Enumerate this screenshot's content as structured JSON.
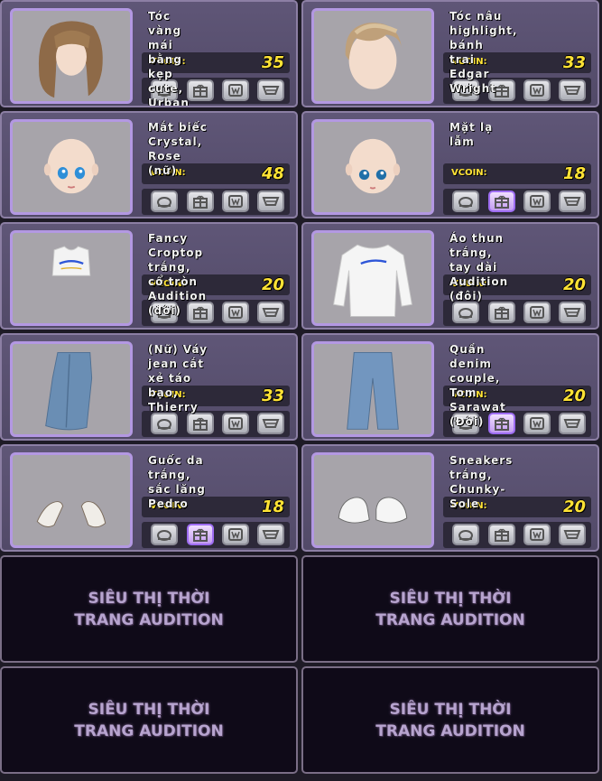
{
  "currency_label": "VCOIN:",
  "items": [
    {
      "name": "Tóc vàng mái bằng kẹp cute, Urban",
      "price": "35",
      "thumb": "hair-blonde",
      "active_button": ""
    },
    {
      "name": "Tóc nâu highlight, bánh trai Edgar Wright",
      "price": "33",
      "thumb": "hair-short",
      "active_button": ""
    },
    {
      "name": "Mắt biếc Crystal, Rose (nữ)",
      "price": "48",
      "thumb": "face-female",
      "active_button": ""
    },
    {
      "name": "Mặt lạ lẫm",
      "price": "18",
      "thumb": "face-male",
      "active_button": "gift"
    },
    {
      "name": "Fancy Croptop trắng, cổ tròn Audition (đôi)",
      "price": "20",
      "thumb": "croptop",
      "active_button": ""
    },
    {
      "name": "Áo thun trắng, tay dài Audition (đôi)",
      "price": "20",
      "thumb": "longsleeve",
      "active_button": ""
    },
    {
      "name": "(Nữ) Váy jean cắt xẻ táo bạo, Thierry",
      "price": "33",
      "thumb": "skirt",
      "active_button": ""
    },
    {
      "name": "Quần denim couple, Tom Sarawat (Đôi)",
      "price": "20",
      "thumb": "jeans",
      "active_button": "gift"
    },
    {
      "name": "Guốc da trắng, sắc lăng Pedro",
      "price": "18",
      "thumb": "heels",
      "active_button": "gift"
    },
    {
      "name": "Sneakers trắng, Chunky-Sole",
      "price": "20",
      "thumb": "sneakers",
      "active_button": ""
    }
  ],
  "ads": [
    {
      "line1": "SIÊU THỊ THỜI",
      "line2": "TRANG AUDITION"
    },
    {
      "line1": "SIÊU THỊ THỜI",
      "line2": "TRANG AUDITION"
    },
    {
      "line1": "SIÊU THỊ THỜI",
      "line2": "TRANG AUDITION"
    },
    {
      "line1": "SIÊU THỊ THỜI",
      "line2": "TRANG AUDITION"
    }
  ],
  "button_icons": [
    "preview-icon",
    "gift-icon",
    "wishlist-icon",
    "cart-icon"
  ],
  "colors": {
    "price": "#ffe335",
    "card": "#5a5270",
    "thumb_border": "#b398e2"
  }
}
